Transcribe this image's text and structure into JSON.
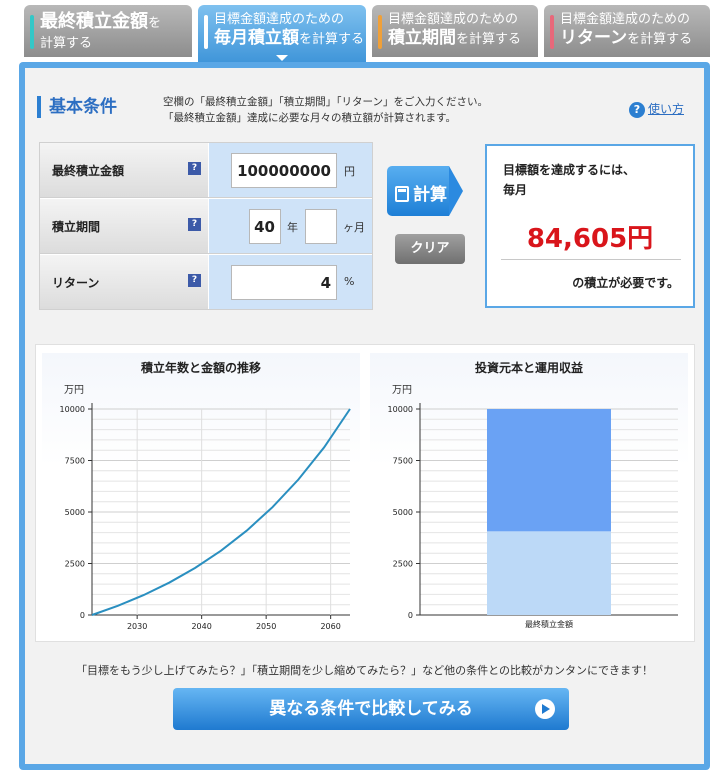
{
  "tabs": [
    {
      "line1": "最終積立金額",
      "line1_suffix": "を",
      "line2": "計算する",
      "bar_color": "#33c7c7"
    },
    {
      "line1": "目標金額達成のための",
      "bold": "毎月積立額",
      "suffix": "を計算する",
      "bar_color": "#ffffff"
    },
    {
      "line1": "目標金額達成のための",
      "bold": "積立期間",
      "suffix": "を計算する",
      "bar_color": "#f0a038"
    },
    {
      "line1": "目標金額達成のための",
      "bold": "リターン",
      "suffix": "を計算する",
      "bar_color": "#e8687a"
    }
  ],
  "section": {
    "title": "基本条件",
    "instr_line1": "空欄の「最終積立金額」「積立期間」「リターン」をご入力ください。",
    "instr_line2": "「最終積立金額」達成に必要な月々の積立額が計算されます。",
    "howto_label": "使い方",
    "help_glyph": "?"
  },
  "form": {
    "target": {
      "label": "最終積立金額",
      "value": "100000000",
      "unit": "円"
    },
    "period": {
      "label": "積立期間",
      "years": "40",
      "years_unit": "年",
      "months": "",
      "months_unit": "ヶ月"
    },
    "return": {
      "label": "リターン",
      "value": "4",
      "unit": "%"
    }
  },
  "buttons": {
    "calc": "計算",
    "clear": "クリア",
    "compare": "異なる条件で比較してみる"
  },
  "result": {
    "line1": "目標額を達成するには、",
    "line2": "毎月",
    "amount": "84,605円",
    "suffix": "の積立が必要です。"
  },
  "footer_note": "「目標をもう少し上げてみたら？」「積立期間を少し縮めてみたら？」など他の条件との比較がカンタンにできます！",
  "chart_data": [
    {
      "type": "line",
      "title": "積立年数と金額の推移",
      "ylabel": "万円",
      "x_ticks": [
        2030,
        2040,
        2050,
        2060
      ],
      "y_ticks": [
        0,
        2500,
        5000,
        7500,
        10000
      ],
      "xlim": [
        2023,
        2063
      ],
      "ylim": [
        0,
        10000
      ],
      "x": [
        2023,
        2027,
        2031,
        2035,
        2039,
        2043,
        2047,
        2051,
        2055,
        2059,
        2063
      ],
      "y": [
        0,
        445,
        966,
        1575,
        2288,
        3122,
        4098,
        5240,
        6577,
        8141,
        10000
      ],
      "line_color": "#2a8fc0"
    },
    {
      "type": "bar",
      "title": "投資元本と運用収益",
      "ylabel": "万円",
      "categories": [
        "最終積立金額"
      ],
      "y_ticks": [
        0,
        2500,
        5000,
        7500,
        10000
      ],
      "ylim": [
        0,
        10000
      ],
      "series": [
        {
          "values": [
            4061
          ],
          "color": "#bcd9f7"
        },
        {
          "values": [
            5939
          ],
          "color": "#6aa2f4"
        }
      ]
    }
  ]
}
